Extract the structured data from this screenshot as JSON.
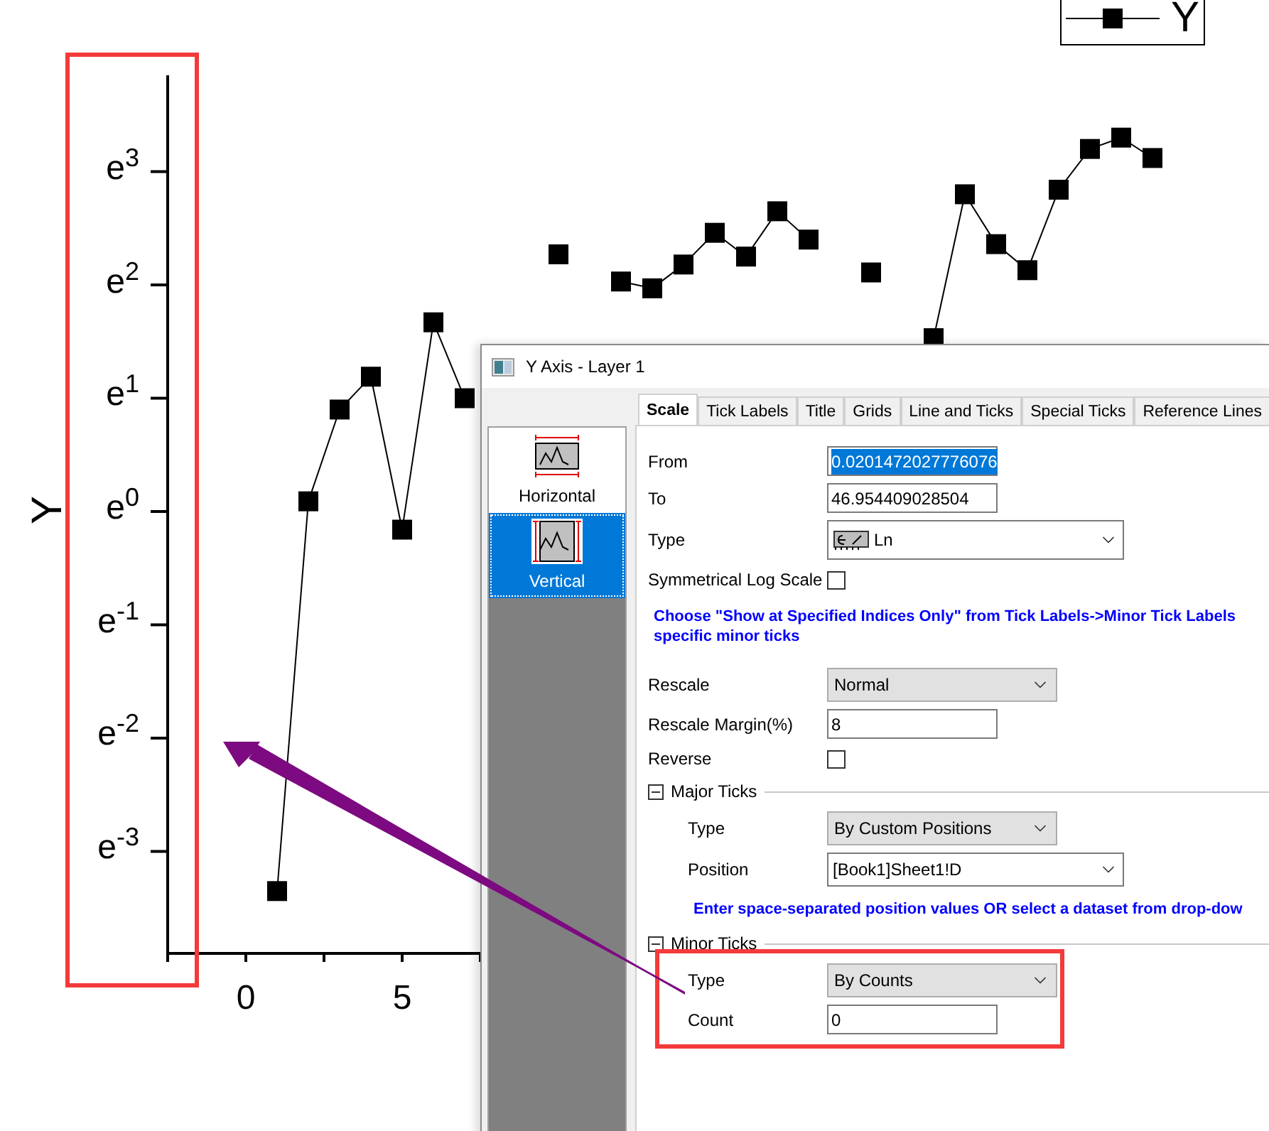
{
  "chart": {
    "chart_data": {
      "type": "line",
      "ylabel": "Y",
      "x": [
        1,
        2,
        3,
        4,
        5,
        6,
        7,
        8,
        9,
        10,
        11,
        12,
        13,
        14,
        15,
        16,
        17,
        18,
        19,
        20,
        21,
        22,
        23,
        24,
        25,
        26,
        27,
        28,
        29
      ],
      "series": [
        {
          "name": "Y",
          "color": "#000000",
          "marker": "square",
          "values": [
            -3.35,
            0.09,
            0.9,
            1.19,
            -0.16,
            1.67,
            1.0,
            null,
            null,
            2.27,
            null,
            2.03,
            1.97,
            2.18,
            2.46,
            2.25,
            2.65,
            2.4,
            null,
            2.11,
            null,
            1.53,
            2.8,
            2.36,
            2.13,
            2.84,
            3.2,
            3.3,
            3.12
          ]
        }
      ],
      "xlim": [
        -2.5,
        33
      ],
      "ylim": [
        -3.9,
        3.85
      ],
      "xticks": [
        0,
        5
      ],
      "yticks": [
        {
          "value": -3,
          "label": "e$^{-3}$"
        },
        {
          "value": -2,
          "label": "e$^{-2}$"
        },
        {
          "value": -1,
          "label": "e$^{-1}$"
        },
        {
          "value": 0,
          "label": "e$^{0}$"
        },
        {
          "value": 1,
          "label": "e$^{1}$"
        },
        {
          "value": 2,
          "label": "e$^{2}$"
        },
        {
          "value": 3,
          "label": "e$^{3}$"
        }
      ]
    }
  },
  "dialog": {
    "title": "Y Axis - Layer 1",
    "axis_list": [
      {
        "kind": "horizontal",
        "label": "Horizontal",
        "selected": false
      },
      {
        "kind": "vertical",
        "label": "Vertical",
        "selected": true
      }
    ],
    "tabs": [
      {
        "label": "Scale",
        "selected": true
      },
      {
        "label": "Tick Labels",
        "selected": false
      },
      {
        "label": "Title",
        "selected": false
      },
      {
        "label": "Grids",
        "selected": false
      },
      {
        "label": "Line and Ticks",
        "selected": false
      },
      {
        "label": "Special Ticks",
        "selected": false
      },
      {
        "label": "Reference Lines",
        "selected": false
      }
    ],
    "rows": [
      {
        "kind": "input",
        "label": "From",
        "value": "0.0201472027776076",
        "text_selected": true
      },
      {
        "kind": "input",
        "label": "To",
        "value": "46.954409028504",
        "text_selected": false
      },
      {
        "kind": "icon-combo",
        "label": "Type",
        "value": "Ln"
      },
      {
        "kind": "checkbox",
        "label": "Symmetrical Log Scale",
        "checked": false
      },
      {
        "kind": "note",
        "lines": [
          "Choose \"Show at Specified Indices Only\" from Tick Labels->Minor Tick Labels",
          "specific minor ticks"
        ]
      },
      {
        "kind": "dropdown",
        "label": "Rescale",
        "value": "Normal"
      },
      {
        "kind": "input",
        "label": "Rescale Margin(%)",
        "value": "8",
        "text_selected": false
      },
      {
        "kind": "checkbox",
        "label": "Reverse",
        "checked": false
      },
      {
        "kind": "section",
        "label": "Major Ticks",
        "expanded": true,
        "children": [
          {
            "kind": "dropdown",
            "label": "Type",
            "value": "By Custom Positions"
          },
          {
            "kind": "combo",
            "label": "Position",
            "value": "[Book1]Sheet1!D"
          },
          {
            "kind": "note",
            "lines": [
              "Enter space-separated position values OR select a dataset from drop-dow"
            ]
          }
        ]
      },
      {
        "kind": "section",
        "label": "Minor Ticks",
        "expanded": true,
        "children": [
          {
            "kind": "dropdown",
            "label": "Type",
            "value": "By Counts"
          },
          {
            "kind": "input",
            "label": "Count",
            "value": "0",
            "text_selected": false
          }
        ]
      }
    ]
  },
  "markup": [
    {
      "kind": "box",
      "color": "#f43a3a"
    },
    {
      "kind": "box",
      "color": "#f43a3a"
    },
    {
      "kind": "arrow",
      "color": "#7d0a80"
    }
  ]
}
